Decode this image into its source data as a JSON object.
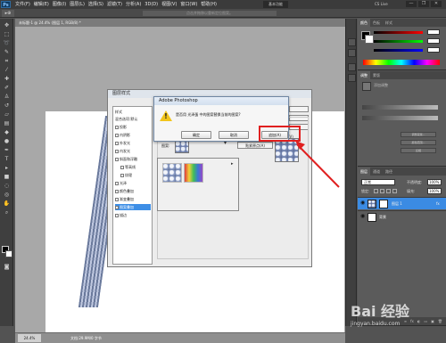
{
  "app": {
    "logo": "Ps",
    "essentials": "基本功能",
    "cs_live": "CS Live",
    "window_buttons": [
      "—",
      "❐",
      "✕"
    ]
  },
  "menu": [
    "文件(F)",
    "编辑(E)",
    "图像(I)",
    "图层(L)",
    "选择(S)",
    "滤镜(T)",
    "分析(A)",
    "3D(D)",
    "视图(V)",
    "窗口(W)",
    "帮助(H)"
  ],
  "options_bar": {
    "tool": "▸⊕",
    "hint": "点击并拖移以重新定位图案。"
  },
  "document": {
    "tab": "未标题-1 @ 24.4% (图层 1, RGB/8) *"
  },
  "status": {
    "zoom": "24.4%",
    "doc_info": "文档:29.9M/0 字节"
  },
  "layer_style_dialog": {
    "title": "图层样式",
    "list": [
      {
        "label": "样式",
        "checkbox": false,
        "selected": false
      },
      {
        "label": "混合选项:默认",
        "checkbox": false,
        "selected": false
      },
      {
        "label": "投影",
        "checkbox": true,
        "selected": false
      },
      {
        "label": "内阴影",
        "checkbox": true,
        "selected": false
      },
      {
        "label": "外发光",
        "checkbox": true,
        "selected": false
      },
      {
        "label": "内发光",
        "checkbox": true,
        "selected": false
      },
      {
        "label": "斜面和浮雕",
        "checkbox": true,
        "selected": false
      },
      {
        "label": "等高线",
        "checkbox": true,
        "selected": false
      },
      {
        "label": "纹理",
        "checkbox": true,
        "selected": false
      },
      {
        "label": "光泽",
        "checkbox": true,
        "selected": false
      },
      {
        "label": "颜色叠加",
        "checkbox": true,
        "selected": false
      },
      {
        "label": "渐变叠加",
        "checkbox": true,
        "selected": false
      },
      {
        "label": "图案叠加",
        "checkbox": true,
        "selected": true
      },
      {
        "label": "描边",
        "checkbox": true,
        "selected": false
      }
    ],
    "pattern_label": "图案:",
    "snap_button": "贴紧原点(A)",
    "side_label": "(V)"
  },
  "alert": {
    "title": "Adobe Photoshop",
    "message": "是否用 光泽蛋 中的图案替换当前的图案?",
    "buttons": {
      "ok": "确定",
      "cancel": "取消",
      "append": "追加(A)"
    }
  },
  "right_panels": {
    "color_tabs": [
      "颜色",
      "色板",
      "样式"
    ],
    "adjust_tabs": [
      "调整",
      "蒙版"
    ],
    "adjust_text": "添加调整",
    "mask_buttons": [
      "调整蒙版...",
      "颜色范围...",
      "反相"
    ],
    "layers_tabs": [
      "图层",
      "通道",
      "路径"
    ]
  },
  "layers": {
    "blend_mode": "正常",
    "opacity_label": "不透明度:",
    "opacity": "100%",
    "lock_label": "锁定:",
    "fill_label": "填充:",
    "fill": "100%",
    "rows": [
      {
        "name": "图层 1",
        "fx": "fx",
        "active": true
      },
      {
        "name": "背景",
        "fx": "",
        "active": false
      }
    ],
    "footer": [
      "∞",
      "fx",
      "◐",
      "▭",
      "▣",
      "🗑"
    ]
  },
  "watermark": {
    "logo": "Bai 经验",
    "url": "jingyan.baidu.com"
  },
  "colors": {
    "highlight": "#e02020",
    "selection": "#3b8be3"
  }
}
